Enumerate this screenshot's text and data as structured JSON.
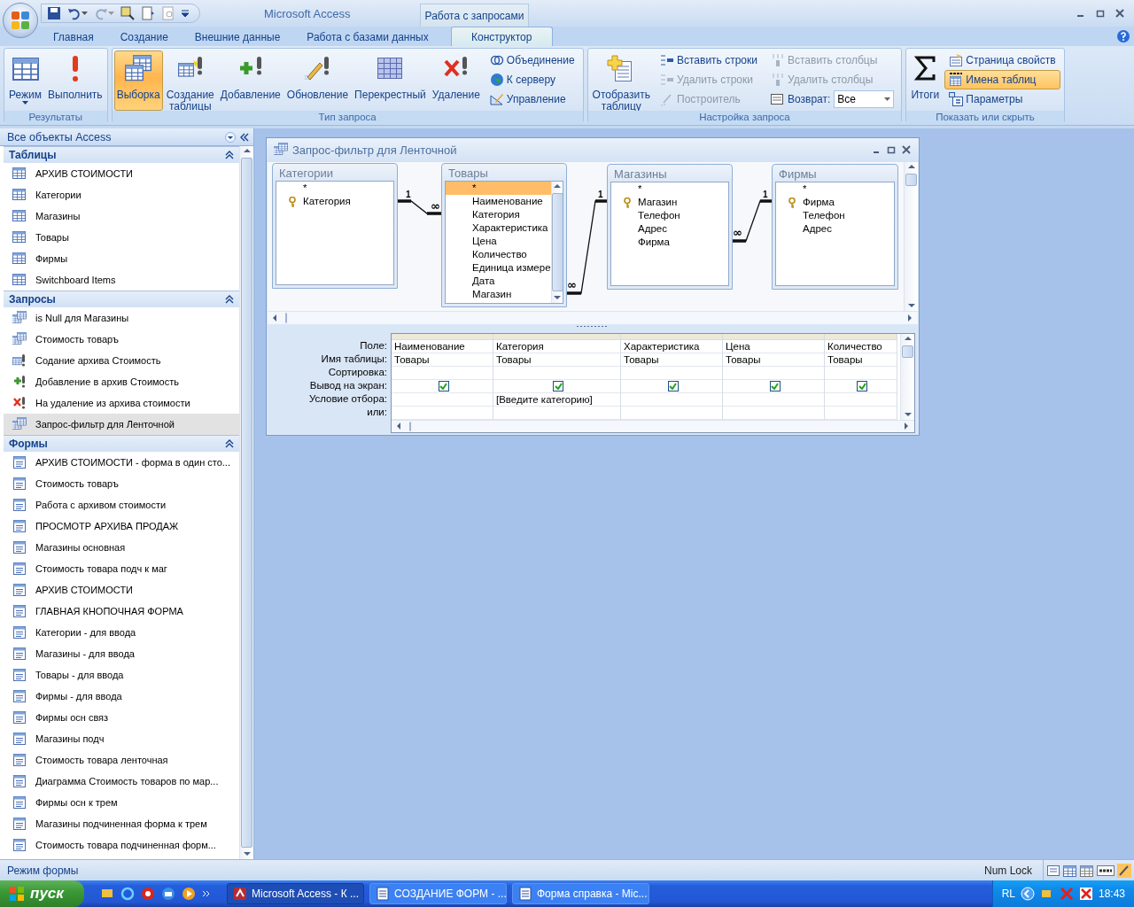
{
  "app": {
    "title": "Microsoft Access",
    "context_tab": "Работа с запросами"
  },
  "ribbon_tabs": [
    {
      "label": "Главная",
      "selected": false
    },
    {
      "label": "Создание",
      "selected": false
    },
    {
      "label": "Внешние данные",
      "selected": false
    },
    {
      "label": "Работа с базами данных",
      "selected": false
    },
    {
      "label": "Конструктор",
      "selected": true
    }
  ],
  "ribbon_groups": [
    {
      "title": "Результаты",
      "items": [
        {
          "kind": "large",
          "label": "Режим",
          "dropdown": true,
          "selected": false
        },
        {
          "kind": "large",
          "label": "Выполнить",
          "selected": false
        }
      ]
    },
    {
      "title": "Тип запроса",
      "items": [
        {
          "kind": "large",
          "label": "Выборка",
          "selected": true
        },
        {
          "kind": "large",
          "label": "Создание таблицы",
          "selected": false
        },
        {
          "kind": "large",
          "label": "Добавление",
          "selected": false
        },
        {
          "kind": "large",
          "label": "Обновление",
          "selected": false
        },
        {
          "kind": "large",
          "label": "Перекрестный",
          "selected": false
        },
        {
          "kind": "large",
          "label": "Удаление",
          "selected": false
        },
        {
          "kind": "stack",
          "items": [
            {
              "kind": "small",
              "label": "Объединение",
              "disabled": false,
              "selected": false
            },
            {
              "kind": "small",
              "label": "К серверу",
              "disabled": false,
              "selected": false
            },
            {
              "kind": "small",
              "label": "Управление",
              "disabled": false,
              "selected": false
            }
          ]
        }
      ]
    },
    {
      "title": "Настройка запроса",
      "items": [
        {
          "kind": "large",
          "label": "Отобразить таблицу",
          "selected": false
        },
        {
          "kind": "stack",
          "items": [
            {
              "kind": "small",
              "label": "Вставить строки",
              "disabled": false,
              "selected": false
            },
            {
              "kind": "small",
              "label": "Удалить строки",
              "disabled": true,
              "selected": false
            },
            {
              "kind": "small",
              "label": "Построитель",
              "disabled": true,
              "selected": false
            }
          ]
        },
        {
          "kind": "stack",
          "items": [
            {
              "kind": "small",
              "label": "Вставить столбцы",
              "disabled": true,
              "selected": false
            },
            {
              "kind": "small",
              "label": "Удалить столбцы",
              "disabled": true,
              "selected": false
            },
            {
              "kind": "combo",
              "label": "Возврат:",
              "value": "Все",
              "disabled": false
            }
          ]
        }
      ]
    },
    {
      "title": "Показать или скрыть",
      "items": [
        {
          "kind": "large",
          "label": "Итоги",
          "selected": false
        },
        {
          "kind": "stack",
          "items": [
            {
              "kind": "small",
              "label": "Страница свойств",
              "disabled": false,
              "selected": false
            },
            {
              "kind": "small",
              "label": "Имена таблиц",
              "disabled": false,
              "selected": true
            },
            {
              "kind": "small",
              "label": "Параметры",
              "disabled": false,
              "selected": false
            }
          ]
        }
      ]
    }
  ],
  "nav_pane": {
    "title": "Все объекты Access",
    "sections": [
      {
        "title": "Таблицы",
        "expanded": true,
        "items": [
          {
            "kind": "table",
            "label": "АРХИВ СТОИМОСТИ",
            "selected": false
          },
          {
            "kind": "table",
            "label": "Категории",
            "selected": false
          },
          {
            "kind": "table",
            "label": "Магазины",
            "selected": false
          },
          {
            "kind": "table",
            "label": "Товары",
            "selected": false
          },
          {
            "kind": "table",
            "label": "Фирмы",
            "selected": false
          },
          {
            "kind": "table",
            "label": "Switchboard Items",
            "selected": false
          }
        ]
      },
      {
        "title": "Запросы",
        "expanded": true,
        "items": [
          {
            "kind": "query",
            "label": "is Null для Магазины",
            "selected": false
          },
          {
            "kind": "query",
            "label": "Стоимость товаръ",
            "selected": false
          },
          {
            "kind": "make_table",
            "label": "Содание архива Стоимость",
            "selected": false
          },
          {
            "kind": "append",
            "label": "Добавление в архив Стоимость",
            "selected": false
          },
          {
            "kind": "delete",
            "label": "На удаление из архива стоимости",
            "selected": false
          },
          {
            "kind": "query",
            "label": "Запрос-фильтр для Ленточной",
            "selected": true
          }
        ]
      },
      {
        "title": "Формы",
        "expanded": true,
        "items": [
          {
            "kind": "form",
            "label": "АРХИВ СТОИМОСТИ - форма в один сто...",
            "selected": false
          },
          {
            "kind": "form",
            "label": "Стоимость товаръ",
            "selected": false
          },
          {
            "kind": "form",
            "label": "Работа с архивом стоимости",
            "selected": false
          },
          {
            "kind": "form",
            "label": "ПРОСМОТР АРХИВА ПРОДАЖ",
            "selected": false
          },
          {
            "kind": "form",
            "label": "Магазины основная",
            "selected": false
          },
          {
            "kind": "form",
            "label": "Стоимость товара подч к маг",
            "selected": false
          },
          {
            "kind": "form",
            "label": "АРХИВ СТОИМОСТИ",
            "selected": false
          },
          {
            "kind": "form",
            "label": "ГЛАВНАЯ КНОПОЧНАЯ ФОРМА",
            "selected": false
          },
          {
            "kind": "form",
            "label": "Категории - для ввода",
            "selected": false
          },
          {
            "kind": "form",
            "label": "Магазины - для ввода",
            "selected": false
          },
          {
            "kind": "form",
            "label": "Товары - для ввода",
            "selected": false
          },
          {
            "kind": "form",
            "label": "Фирмы - для ввода",
            "selected": false
          },
          {
            "kind": "form",
            "label": "Фирмы осн связ",
            "selected": false
          },
          {
            "kind": "form",
            "label": "Магазины подч",
            "selected": false
          },
          {
            "kind": "form",
            "label": "Стоимость товара ленточная",
            "selected": false
          },
          {
            "kind": "form",
            "label": "Диаграмма Стоимость товаров по  мар...",
            "selected": false
          },
          {
            "kind": "form",
            "label": "Фирмы осн к трем",
            "selected": false
          },
          {
            "kind": "form",
            "label": "Магазины подчиненная форма к трем",
            "selected": false
          },
          {
            "kind": "form",
            "label": "Стоимость товара подчиненная форм...",
            "selected": false
          }
        ]
      }
    ]
  },
  "query_window": {
    "title": "Запрос-фильтр для Ленточной",
    "tables": [
      {
        "name": "Категории",
        "scrollable": false,
        "fields": [
          {
            "name": "*",
            "key": false,
            "selected": false
          },
          {
            "name": "Категория",
            "key": true,
            "selected": false
          }
        ]
      },
      {
        "name": "Товары",
        "scrollable": true,
        "fields": [
          {
            "name": "*",
            "key": false,
            "selected": true
          },
          {
            "name": "Наименование",
            "key": false,
            "selected": false
          },
          {
            "name": "Категория",
            "key": false,
            "selected": false
          },
          {
            "name": "Характеристика",
            "key": false,
            "selected": false
          },
          {
            "name": "Цена",
            "key": false,
            "selected": false
          },
          {
            "name": "Количество",
            "key": false,
            "selected": false
          },
          {
            "name": "Единица измере",
            "key": false,
            "selected": false
          },
          {
            "name": "Дата",
            "key": false,
            "selected": false
          },
          {
            "name": "Магазин",
            "key": false,
            "selected": false
          }
        ]
      },
      {
        "name": "Магазины",
        "scrollable": false,
        "fields": [
          {
            "name": "*",
            "key": false,
            "selected": false
          },
          {
            "name": "Магазин",
            "key": true,
            "selected": false
          },
          {
            "name": "Телефон",
            "key": false,
            "selected": false
          },
          {
            "name": "Адрес",
            "key": false,
            "selected": false
          },
          {
            "name": "Фирма",
            "key": false,
            "selected": false
          }
        ]
      },
      {
        "name": "Фирмы",
        "scrollable": false,
        "fields": [
          {
            "name": "*",
            "key": false,
            "selected": false
          },
          {
            "name": "Фирма",
            "key": true,
            "selected": false
          },
          {
            "name": "Телефон",
            "key": false,
            "selected": false
          },
          {
            "name": "Адрес",
            "key": false,
            "selected": false
          }
        ]
      }
    ],
    "joins": [
      {
        "one_mark": "1",
        "many_mark": "∞"
      },
      {
        "one_mark": "1",
        "many_mark": "∞"
      },
      {
        "one_mark": "1",
        "many_mark": "∞"
      }
    ],
    "grid": {
      "row_labels": [
        "Поле:",
        "Имя таблицы:",
        "Сортировка:",
        "Вывод на экран:",
        "Условие отбора:",
        "или:"
      ],
      "columns": [
        {
          "field": "Наименование",
          "table": "Товары",
          "show": true
        },
        {
          "field": "Категория",
          "table": "Товары",
          "show": true,
          "criteria": "[Введите категорию]"
        },
        {
          "field": "Характеристика",
          "table": "Товары",
          "show": true
        },
        {
          "field": "Цена",
          "table": "Товары",
          "show": true
        },
        {
          "field": "Количество",
          "table": "Товары",
          "show": true
        }
      ]
    }
  },
  "status_bar": {
    "left": "Режим формы",
    "right": "Num Lock"
  },
  "taskbar": {
    "start": "пуск",
    "tasks": [
      {
        "label": "Microsoft Access - К ...",
        "kind": "access",
        "selected": true
      },
      {
        "label": "СОЗДАНИЕ ФОРМ - ...",
        "kind": "word",
        "selected": false
      },
      {
        "label": "Форма справка - Mic...",
        "kind": "word",
        "selected": false
      }
    ],
    "language": "RL",
    "clock": "18:43"
  }
}
